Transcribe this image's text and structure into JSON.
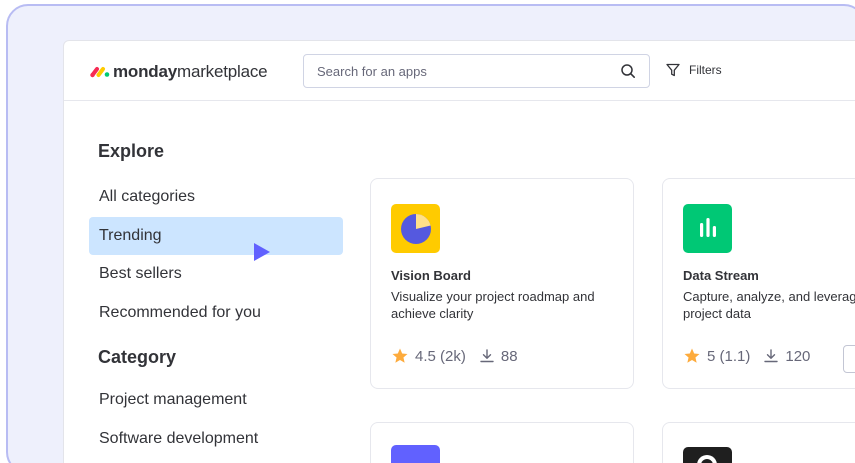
{
  "brand": {
    "bold": "monday",
    "light": "marketplace"
  },
  "search": {
    "placeholder": "Search for an apps"
  },
  "filters_label": "Filters",
  "sidebar": {
    "explore_title": "Explore",
    "explore_items": [
      {
        "label": "All categories"
      },
      {
        "label": "Trending",
        "active": true
      },
      {
        "label": "Best sellers"
      },
      {
        "label": "Recommended for you"
      }
    ],
    "category_title": "Category",
    "category_items": [
      {
        "label": "Project management"
      },
      {
        "label": "Software development"
      }
    ]
  },
  "apps": [
    {
      "name": "Vision Board",
      "description": "Visualize your project roadmap and achieve clarity",
      "rating": "4.5 (2k)",
      "installs": "88",
      "icon": "pie-chart-icon",
      "icon_color": "#ffcb00"
    },
    {
      "name": "Data Stream",
      "description": "Capture, analyze, and leverage project data",
      "rating": "5 (1.1)",
      "installs": "120",
      "icon": "bar-chart-icon",
      "icon_color": "#00c875"
    }
  ],
  "colors": {
    "accent": "#6161ff",
    "active_bg": "#cce5ff",
    "star": "#fdab3d",
    "frame_border": "#b8bcf3",
    "frame_bg": "#eef0fc"
  }
}
